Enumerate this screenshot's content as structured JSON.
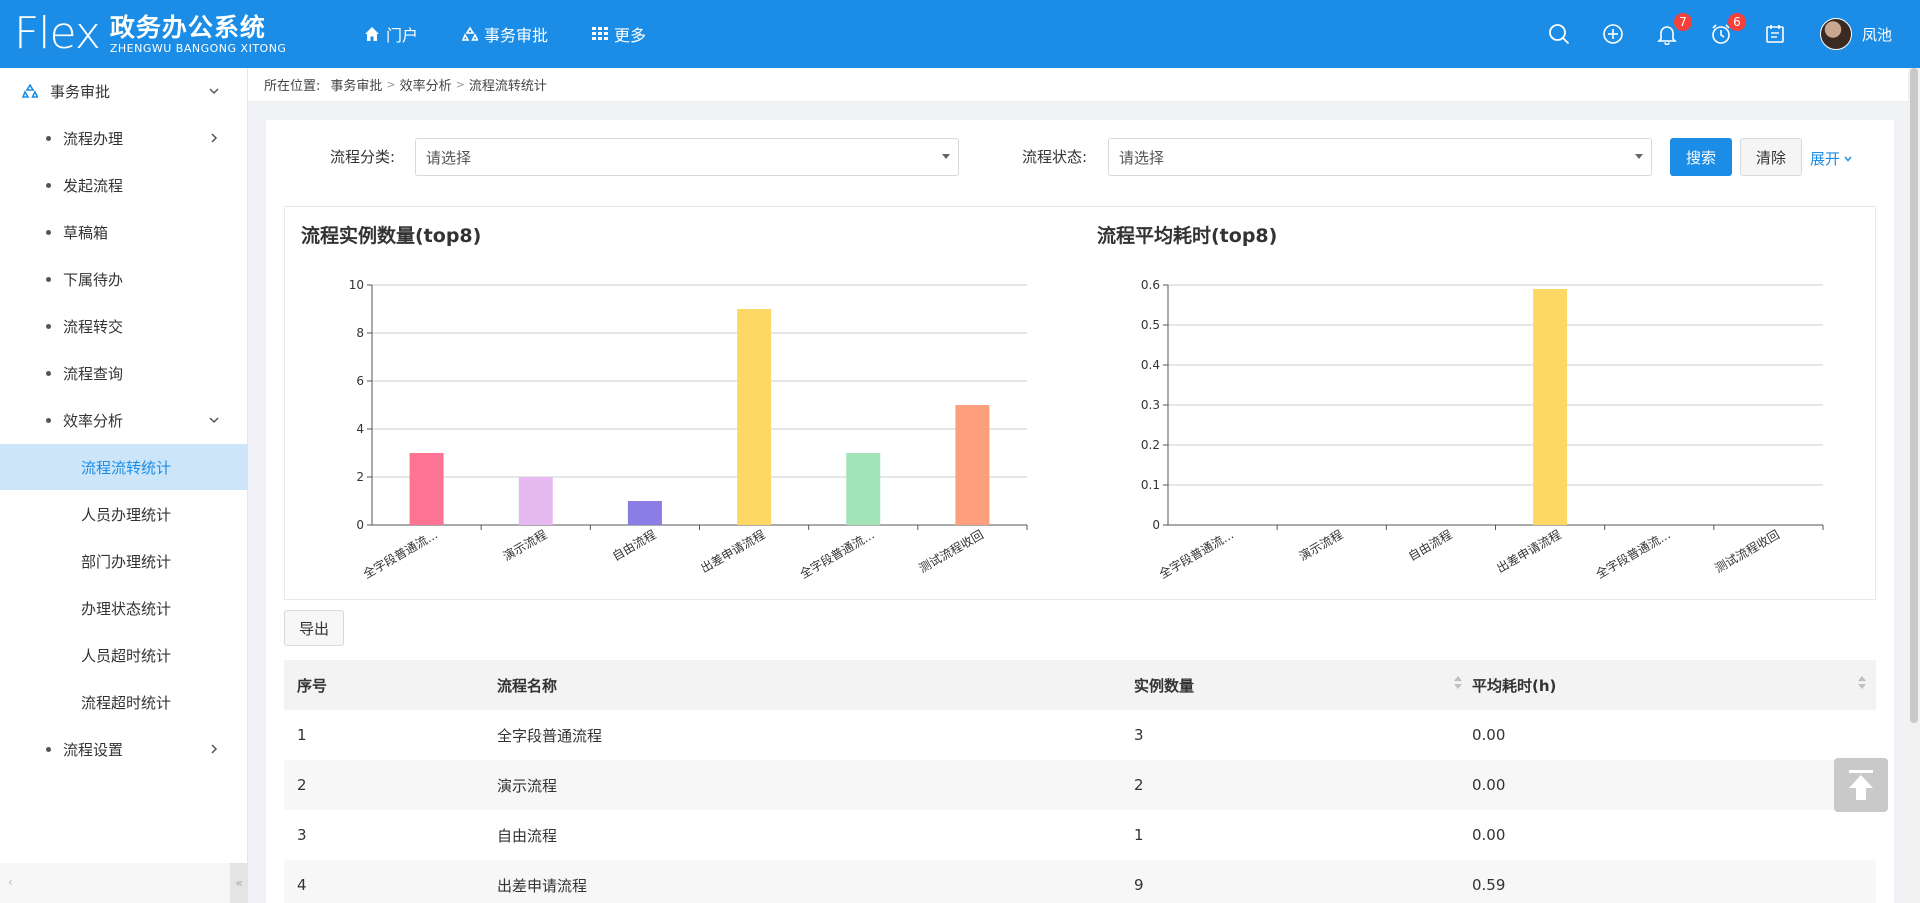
{
  "app": {
    "logo_word": "Flex",
    "title": "政务办公系统",
    "subtitle": "ZHENGWU BANGONG XITONG"
  },
  "nav": [
    {
      "label": "门户",
      "icon": "home-icon"
    },
    {
      "label": "事务审批",
      "icon": "recycle-icon"
    },
    {
      "label": "更多",
      "icon": "grid-icon"
    }
  ],
  "topbar": {
    "notifications_count": "7",
    "alarms_count": "6",
    "username": "凤池"
  },
  "sidebar": {
    "root": "事务审批",
    "items": [
      {
        "label": "流程办理",
        "expandable": true
      },
      {
        "label": "发起流程"
      },
      {
        "label": "草稿箱"
      },
      {
        "label": "下属待办"
      },
      {
        "label": "流程转交"
      },
      {
        "label": "流程查询"
      },
      {
        "label": "效率分析",
        "expanded": true
      }
    ],
    "sub_items": [
      {
        "label": "流程流转统计",
        "active": true
      },
      {
        "label": "人员办理统计"
      },
      {
        "label": "部门办理统计"
      },
      {
        "label": "办理状态统计"
      },
      {
        "label": "人员超时统计"
      },
      {
        "label": "流程超时统计"
      }
    ],
    "last_item": "流程设置"
  },
  "breadcrumb": {
    "prefix": "所在位置:",
    "items": [
      "事务审批",
      "效率分析",
      "流程流转统计"
    ]
  },
  "filters": {
    "category_label": "流程分类:",
    "category_value": "请选择",
    "status_label": "流程状态:",
    "status_value": "请选择",
    "search_label": "搜索",
    "clear_label": "清除",
    "expand_label": "展开"
  },
  "chart_data": [
    {
      "type": "bar",
      "title": "流程实例数量(top8)",
      "categories": [
        "全字段普通流...",
        "演示流程",
        "自由流程",
        "出差申请流程",
        "全字段普通流...",
        "测试流程收回"
      ],
      "values": [
        3,
        2,
        1,
        9,
        3,
        5
      ],
      "colors": [
        "#fd7394",
        "#e6b9f1",
        "#8a7ee6",
        "#fed864",
        "#a3e3b8",
        "#fd9f7c"
      ],
      "yticks": [
        "0",
        "2",
        "4",
        "6",
        "8",
        "10"
      ],
      "ylim": [
        0,
        10
      ]
    },
    {
      "type": "bar",
      "title": "流程平均耗时(top8)",
      "categories": [
        "全字段普通流...",
        "演示流程",
        "自由流程",
        "出差申请流程",
        "全字段普通流...",
        "测试流程收回"
      ],
      "values": [
        0,
        0,
        0,
        0.59,
        0,
        0
      ],
      "colors": [
        "#fd7394",
        "#e6b9f1",
        "#8a7ee6",
        "#fed864",
        "#a3e3b8",
        "#fd9f7c"
      ],
      "yticks": [
        "0",
        "0.1",
        "0.2",
        "0.3",
        "0.4",
        "0.5",
        "0.6"
      ],
      "ylim": [
        0,
        0.6
      ]
    }
  ],
  "export_label": "导出",
  "table": {
    "headers": [
      "序号",
      "流程名称",
      "实例数量",
      "平均耗时(h)"
    ],
    "rows": [
      [
        "1",
        "全字段普通流程",
        "3",
        "0.00"
      ],
      [
        "2",
        "演示流程",
        "2",
        "0.00"
      ],
      [
        "3",
        "自由流程",
        "1",
        "0.00"
      ],
      [
        "4",
        "出差申请流程",
        "9",
        "0.59"
      ]
    ]
  }
}
